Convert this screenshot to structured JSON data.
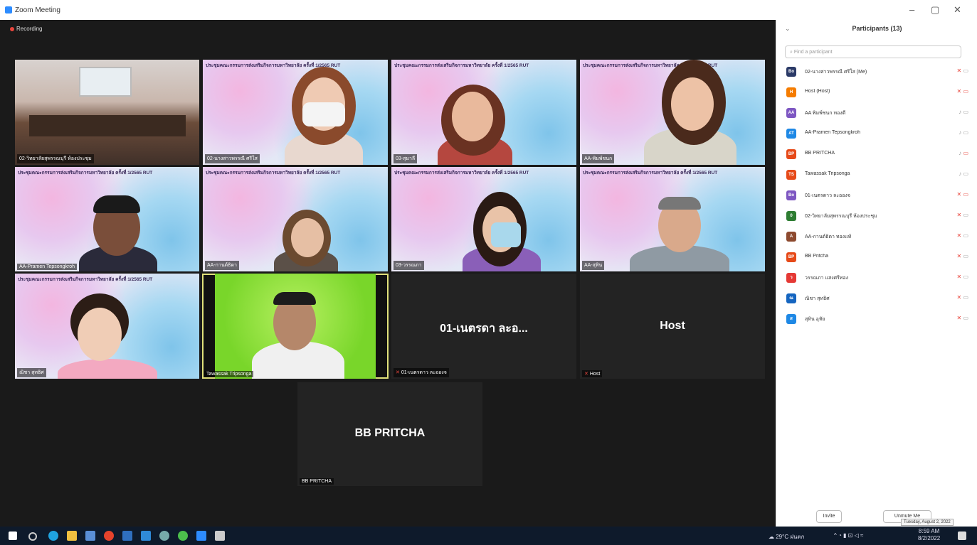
{
  "window": {
    "title": "Zoom Meeting",
    "minimize": "–",
    "maximize": "▢",
    "close": "✕"
  },
  "recording": {
    "label": "Recording"
  },
  "banner_text": "ประชุมคณะกรรมการส่งเสริมกิจการมหาวิทยาลัย ครั้งที่ 1/2565 RUT",
  "tiles": [
    {
      "label": "02-วิทยาลัยสุพรรณบุรี ห้องประชุม"
    },
    {
      "label": "02-นางสาวพรรณี ศรีใส"
    },
    {
      "label": "03-สุมาลี"
    },
    {
      "label": "AA-พิมพ์ชนก"
    },
    {
      "label": "AA-Pramen Tepsongkroh"
    },
    {
      "label": "AA-กานต์ธิดา"
    },
    {
      "label": "03-วรรณภา"
    },
    {
      "label": "AA-สุทิน"
    },
    {
      "label": "ณิชา สุทธิศ"
    },
    {
      "label": "Tawassak Tripsonga"
    },
    {
      "label": "01-เนตรดาว ละอองจ",
      "big": "01-เนตรดา ละอ..."
    },
    {
      "label": "Host",
      "big": "Host"
    },
    {
      "label": "BB PRITCHA",
      "big": "BB PRITCHA"
    }
  ],
  "panel": {
    "title": "Participants (13)",
    "search_placeholder": "Find a participant",
    "participants": [
      {
        "initials": "Bo",
        "name": "02-นางสาวพรรณี ศรีใส (Me)",
        "color": "#2b3a67"
      },
      {
        "initials": "H",
        "name": "Host (Host)",
        "color": "#f57c00"
      },
      {
        "initials": "AA",
        "name": "AA พิมพ์ชนก ทองดี",
        "color": "#7e57c2"
      },
      {
        "initials": "AT",
        "name": "AA-Pramen Tepsongkroh",
        "color": "#1e88e5"
      },
      {
        "initials": "BP",
        "name": "BB PRITCHA",
        "color": "#e64a19"
      },
      {
        "initials": "TS",
        "name": "Tawassak Tripsonga",
        "color": "#e64a19"
      },
      {
        "initials": "Bo",
        "name": "01-เนตรดาว ละอองจ",
        "color": "#7e57c2"
      },
      {
        "initials": "0",
        "name": "02-วิทยาลัยสุพรรณบุรี ห้องประชุม",
        "color": "#2e7d32"
      },
      {
        "initials": "A",
        "name": "AA-กานต์ธิดา ทองแท้",
        "color": "#8d4a2f"
      },
      {
        "initials": "BP",
        "name": "BB Pritcha",
        "color": "#e64a19"
      },
      {
        "initials": "ว",
        "name": "วรรณภา แสงศรีทอง",
        "color": "#e53935"
      },
      {
        "initials": "ณ",
        "name": "ณิชา สุทธิศ",
        "color": "#1565c0"
      },
      {
        "initials": "ส",
        "name": "สุทิน อุทัย",
        "color": "#1e88e5"
      }
    ],
    "invite_label": "Invite",
    "unmute_label": "Unmute Me"
  },
  "taskbar": {
    "weather": "29°C ฝนตก",
    "time": "8:59 AM",
    "date": "8/2/2022",
    "tooltip": "Tuesday, August 2, 2022"
  }
}
